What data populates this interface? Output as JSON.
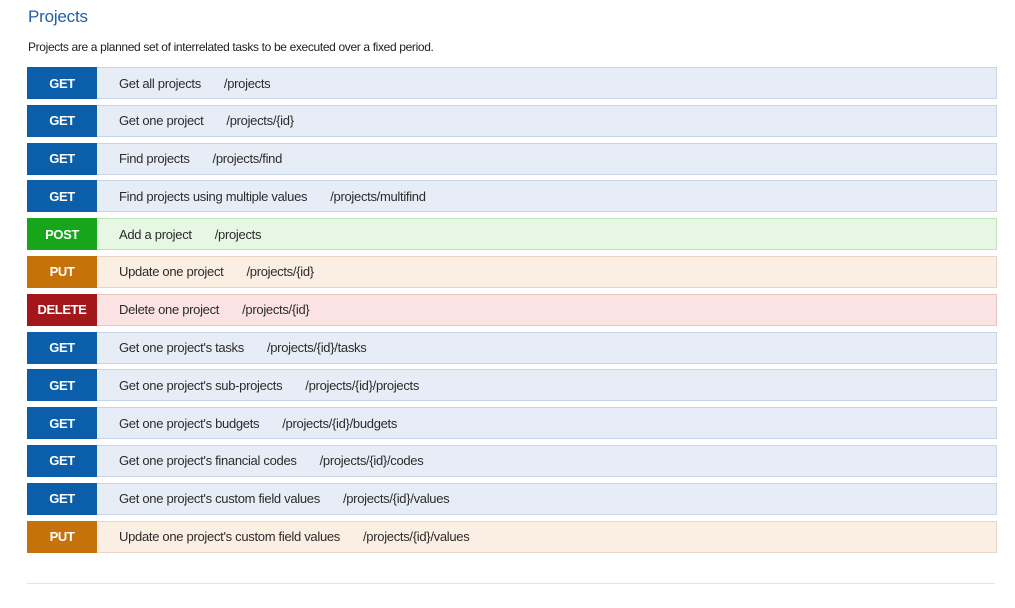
{
  "section": {
    "title": "Projects",
    "description": "Projects are a planned set of interrelated tasks to be executed over a fixed period."
  },
  "endpoints": [
    {
      "method": "GET",
      "summary": "Get all projects",
      "path": "/projects"
    },
    {
      "method": "GET",
      "summary": "Get one project",
      "path": "/projects/{id}"
    },
    {
      "method": "GET",
      "summary": "Find projects",
      "path": "/projects/find"
    },
    {
      "method": "GET",
      "summary": "Find projects using multiple values",
      "path": "/projects/multifind"
    },
    {
      "method": "POST",
      "summary": "Add a project",
      "path": "/projects"
    },
    {
      "method": "PUT",
      "summary": "Update one project",
      "path": "/projects/{id}"
    },
    {
      "method": "DELETE",
      "summary": "Delete one project",
      "path": "/projects/{id}"
    },
    {
      "method": "GET",
      "summary": "Get one project's tasks",
      "path": "/projects/{id}/tasks"
    },
    {
      "method": "GET",
      "summary": "Get one project's sub-projects",
      "path": "/projects/{id}/projects"
    },
    {
      "method": "GET",
      "summary": "Get one project's budgets",
      "path": "/projects/{id}/budgets"
    },
    {
      "method": "GET",
      "summary": "Get one project's financial codes",
      "path": "/projects/{id}/codes"
    },
    {
      "method": "GET",
      "summary": "Get one project's custom field values",
      "path": "/projects/{id}/values"
    },
    {
      "method": "PUT",
      "summary": "Update one project's custom field values",
      "path": "/projects/{id}/values"
    }
  ],
  "colors": {
    "title": "#1f5fa8",
    "get": "#0b5ea9",
    "post": "#17a51b",
    "put": "#c6720a",
    "delete": "#a3161a"
  }
}
